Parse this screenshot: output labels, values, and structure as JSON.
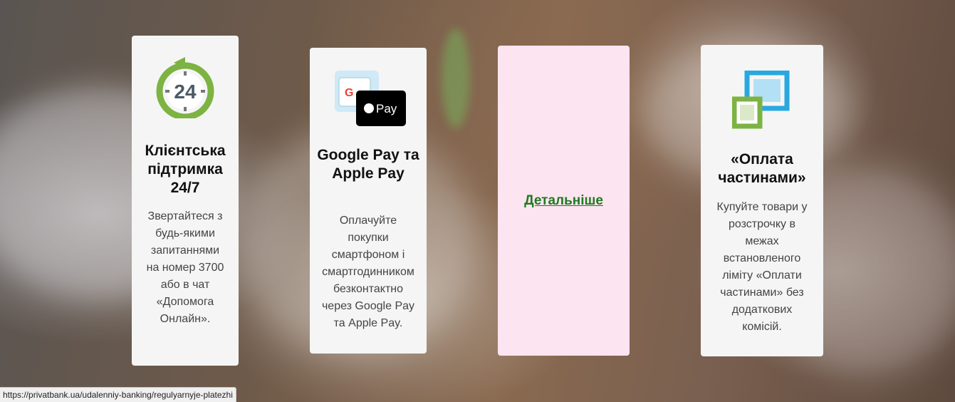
{
  "cards": [
    {
      "icon": "clock-24-icon",
      "title": "Клієнтська підтримка 24/7",
      "icon_text": "24",
      "description": "Звертайтеся з будь-якими запитаннями на номер 3700 або в чат «Допомога Онлайн»."
    },
    {
      "icon": "google-apple-pay-icon",
      "title": "Google Pay та Apple Pay",
      "icon_text": "Pay",
      "description": "Оплачуйте покупки смартфоном і смартгодинником безконтактно через Google Pay та Apple Pay."
    },
    {
      "link_label": "Детальніше"
    },
    {
      "icon": "installments-squares-icon",
      "title": "«Оплата частинами»",
      "description": "Купуйте товари у розстрочку в межах встановленого ліміту «Оплати частинами» без додаткових комісій."
    }
  ],
  "colors": {
    "green": "#7cb342",
    "blue": "#29a8e0",
    "link": "#1f7a1f",
    "highlight_card": "#fde4f1"
  },
  "status_url": "https://privatbank.ua/udalenniy-banking/regulyarnyje-platezhi"
}
